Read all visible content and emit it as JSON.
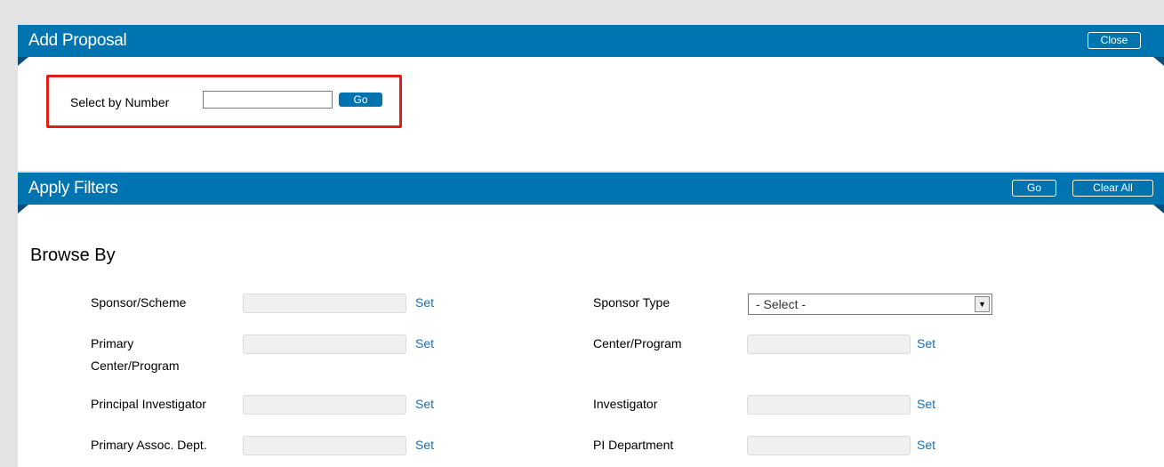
{
  "add_proposal": {
    "title": "Add Proposal",
    "close_label": "Close",
    "select_by_number_label": "Select by Number",
    "number_value": "",
    "go_label": "Go"
  },
  "filters": {
    "title": "Apply Filters",
    "go_label": "Go",
    "clear_all_label": "Clear All",
    "browse_by_title": "Browse By",
    "set_label": "Set",
    "left": [
      {
        "label": "Sponsor/Scheme"
      },
      {
        "label_line1": "Primary",
        "label_line2": "Center/Program"
      },
      {
        "label": "Principal Investigator"
      },
      {
        "label": "Primary Assoc. Dept."
      }
    ],
    "right": [
      {
        "label": "Sponsor Type",
        "select_value": "- Select -"
      },
      {
        "label": "Center/Program"
      },
      {
        "label": "Investigator"
      },
      {
        "label": "PI Department"
      }
    ]
  },
  "colors": {
    "header_bar": "#0073b1",
    "highlight_border": "#e41b17",
    "link": "#1a6fb5"
  }
}
